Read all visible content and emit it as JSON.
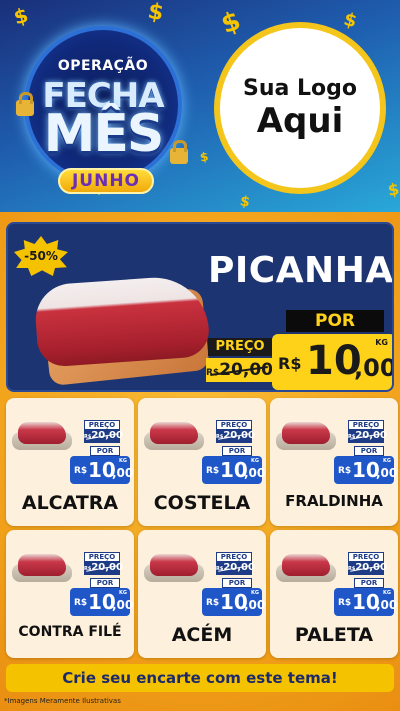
{
  "header": {
    "badge": {
      "line1": "OPERAÇÃO",
      "line2": "FECHA",
      "line3": "MÊS",
      "month": "JUNHO"
    },
    "logo": {
      "line1": "Sua Logo",
      "line2": "Aqui"
    },
    "decor_symbol": "$"
  },
  "featured": {
    "discount": "-50%",
    "name": "PICANHA",
    "old_label": "PREÇO",
    "old_currency": "R$",
    "old_price": "20,00",
    "new_label": "POR",
    "new_currency": "R$",
    "new_int": "10",
    "new_dec": ",00",
    "unit": "KG"
  },
  "products": [
    {
      "name": "ALCATRA",
      "old_label": "PREÇO",
      "old_currency": "R$",
      "old_price": "20,00",
      "new_label": "POR",
      "currency": "R$",
      "int": "10",
      "dec": ",00",
      "unit": "KG"
    },
    {
      "name": "COSTELA",
      "old_label": "PREÇO",
      "old_currency": "R$",
      "old_price": "20,00",
      "new_label": "POR",
      "currency": "R$",
      "int": "10",
      "dec": ",00",
      "unit": "KG"
    },
    {
      "name": "FRALDINHA",
      "old_label": "PREÇO",
      "old_currency": "R$",
      "old_price": "20,00",
      "new_label": "POR",
      "currency": "R$",
      "int": "10",
      "dec": ",00",
      "unit": "KG"
    },
    {
      "name": "CONTRA FILÉ",
      "old_label": "PREÇO",
      "old_currency": "R$",
      "old_price": "20,00",
      "new_label": "POR",
      "currency": "R$",
      "int": "10",
      "dec": ",00",
      "unit": "KG"
    },
    {
      "name": "ACÉM",
      "old_label": "PREÇO",
      "old_currency": "R$",
      "old_price": "20,00",
      "new_label": "POR",
      "currency": "R$",
      "int": "10",
      "dec": ",00",
      "unit": "KG"
    },
    {
      "name": "PALETA",
      "old_label": "PREÇO",
      "old_currency": "R$",
      "old_price": "20,00",
      "new_label": "POR",
      "currency": "R$",
      "int": "10",
      "dec": ",00",
      "unit": "KG"
    }
  ],
  "cta": "Crie seu encarte com este tema!",
  "disclaimer": "*Imagens Meramente Ilustrativas",
  "colors": {
    "navy": "#1c3471",
    "yellow": "#f5c200",
    "orange": "#f2a21a",
    "blue": "#1f57c8"
  }
}
